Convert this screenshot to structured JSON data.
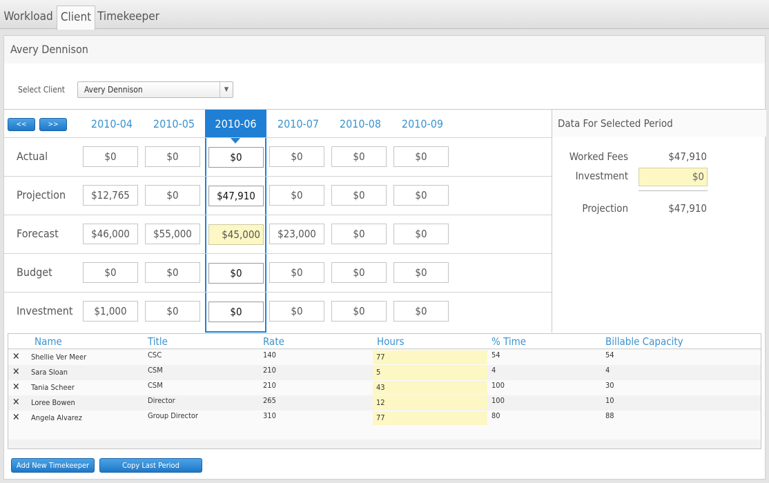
{
  "tabs": [
    {
      "label": "Workload"
    },
    {
      "label": "Client"
    },
    {
      "label": "Timekeeper"
    }
  ],
  "panel": {
    "title": "Avery Dennison",
    "select_label": "Select Client",
    "select_value": "Avery Dennison"
  },
  "nav": {
    "prev": "<<",
    "next": ">>"
  },
  "periods": [
    "2010-04",
    "2010-05",
    "2010-06",
    "2010-07",
    "2010-08",
    "2010-09"
  ],
  "selected_period": "2010-06",
  "rows": [
    {
      "label": "Actual",
      "values": [
        "$0",
        "$0",
        "$0",
        "$0",
        "$0",
        "$0"
      ]
    },
    {
      "label": "Projection",
      "values": [
        "$12,765",
        "$0",
        "$47,910",
        "$0",
        "$0",
        "$0"
      ]
    },
    {
      "label": "Forecast",
      "values": [
        "$46,000",
        "$55,000",
        "$45,000",
        "$23,000",
        "$0",
        "$0"
      ]
    },
    {
      "label": "Budget",
      "values": [
        "$0",
        "$0",
        "$0",
        "$0",
        "$0",
        "$0"
      ]
    },
    {
      "label": "Investment",
      "values": [
        "$1,000",
        "$0",
        "$0",
        "$0",
        "$0",
        "$0"
      ]
    }
  ],
  "side": {
    "title": "Data For Selected Period",
    "worked_fees_label": "Worked Fees",
    "worked_fees_value": "$47,910",
    "investment_label": "Investment",
    "investment_value": "$0",
    "projection_label": "Projection",
    "projection_value": "$47,910"
  },
  "table": {
    "headers": [
      "Name",
      "Title",
      "Rate",
      "Hours",
      "% Time",
      "Billable Capacity"
    ],
    "rows": [
      {
        "name": "Shellie Ver Meer",
        "title": "CSC",
        "rate": "140",
        "hours": "77",
        "pct": "54",
        "cap": "54"
      },
      {
        "name": "Sara Sloan",
        "title": "CSM",
        "rate": "210",
        "hours": "5",
        "pct": "4",
        "cap": "4"
      },
      {
        "name": "Tania Scheer",
        "title": "CSM",
        "rate": "210",
        "hours": "43",
        "pct": "100",
        "cap": "30"
      },
      {
        "name": "Loree Bowen",
        "title": "Director",
        "rate": "265",
        "hours": "12",
        "pct": "100",
        "cap": "10"
      },
      {
        "name": "Angela Alvarez",
        "title": "Group Director",
        "rate": "310",
        "hours": "77",
        "pct": "80",
        "cap": "88"
      }
    ]
  },
  "footer": {
    "add_label": "Add New Timekeeper",
    "copy_label": "Copy Last Period"
  }
}
